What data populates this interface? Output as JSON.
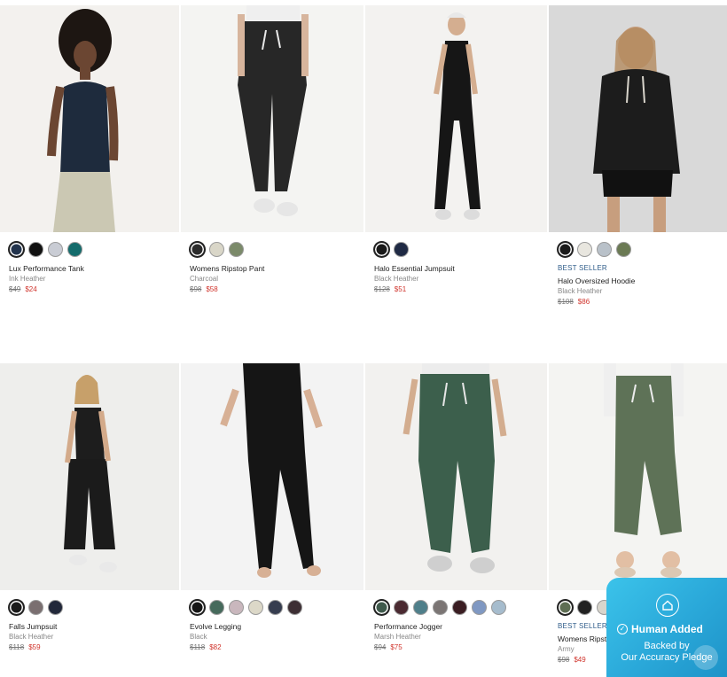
{
  "products": [
    {
      "name": "Lux Performance Tank",
      "color": "Ink Heather",
      "was": "$49",
      "now": "$24",
      "badge": "",
      "swatches": [
        "#23344d",
        "#111111",
        "#c9ccd4",
        "#146c6c"
      ]
    },
    {
      "name": "Womens Ripstop Pant",
      "color": "Charcoal",
      "was": "$98",
      "now": "$58",
      "badge": "",
      "swatches": [
        "#2b2b2b",
        "#d9d6c8",
        "#7b8a6a"
      ]
    },
    {
      "name": "Halo Essential Jumpsuit",
      "color": "Black Heather",
      "was": "$128",
      "now": "$51",
      "badge": "",
      "swatches": [
        "#1a1a1a",
        "#1f2a44"
      ]
    },
    {
      "name": "Halo Oversized Hoodie",
      "color": "Black Heather",
      "was": "$108",
      "now": "$86",
      "badge": "BEST SELLER",
      "swatches": [
        "#1b1b1b",
        "#e8e6df",
        "#b9c1c9",
        "#6b7a54"
      ]
    },
    {
      "name": "Falls Jumpsuit",
      "color": "Black Heather",
      "was": "$118",
      "now": "$59",
      "badge": "",
      "swatches": [
        "#1b1b1b",
        "#7a6f70",
        "#22283a"
      ]
    },
    {
      "name": "Evolve Legging",
      "color": "Black",
      "was": "$118",
      "now": "$82",
      "badge": "",
      "swatches": [
        "#151515",
        "#466a5c",
        "#c9b7bd",
        "#dcd8c8",
        "#363d4f",
        "#3d2f34"
      ]
    },
    {
      "name": "Performance Jogger",
      "color": "Marsh Heather",
      "was": "$94",
      "now": "$75",
      "badge": "",
      "swatches": [
        "#3f5a4c",
        "#4a2a31",
        "#4f7f8a",
        "#7b7574",
        "#3a1d22",
        "#7f98c2",
        "#a6bccd"
      ]
    },
    {
      "name": "Womens Ripstop Pant",
      "color": "Army",
      "was": "$98",
      "now": "$49",
      "badge": "BEST SELLER",
      "swatches": [
        "#5e6e53",
        "#222222",
        "#d8d5cc"
      ]
    }
  ],
  "trust_badge": {
    "title": "Human Added",
    "line1": "Backed by",
    "line2": "Our Accuracy Pledge",
    "check_glyph": "✓",
    "icon": "home-icon"
  }
}
